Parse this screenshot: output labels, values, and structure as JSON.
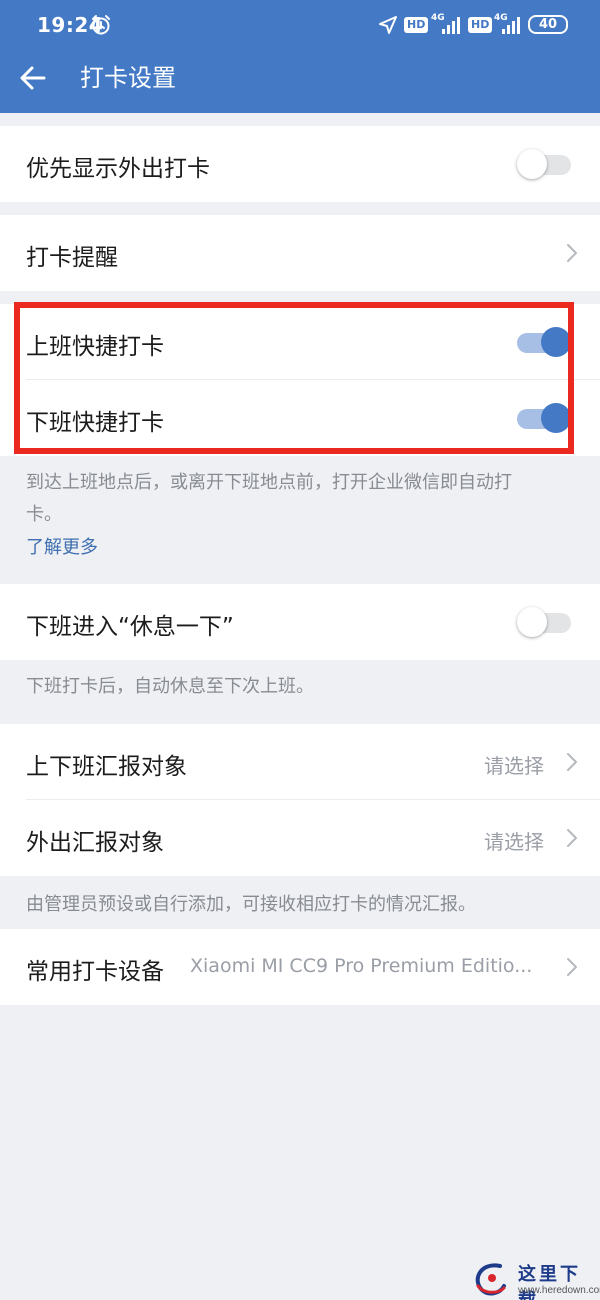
{
  "status_bar": {
    "time": "19:24",
    "hd_1": "HD",
    "net_1": "4G",
    "hd_2": "HD",
    "net_2": "4G",
    "battery": "40"
  },
  "header": {
    "title": "打卡设置"
  },
  "settings": {
    "prefer_outing": {
      "label": "优先显示外出打卡",
      "enabled": false
    },
    "clock_reminder": {
      "label": "打卡提醒"
    },
    "quick_clock_in": {
      "label": "上班快捷打卡",
      "enabled": true
    },
    "quick_clock_out": {
      "label": "下班快捷打卡",
      "enabled": true
    },
    "quick_desc_1": "到达上班地点后，或离开下班地点前，打开企业微信即自动打",
    "quick_desc_2": "卡。",
    "learn_more": "了解更多",
    "rest_after_work": {
      "label": "下班进入“休息一下”",
      "enabled": false
    },
    "rest_desc": "下班打卡后，自动休息至下次上班。",
    "report_commute": {
      "label": "上下班汇报对象",
      "value": "请选择"
    },
    "report_outing": {
      "label": "外出汇报对象",
      "value": "请选择"
    },
    "report_desc": "由管理员预设或自行添加，可接收相应打卡的情况汇报。",
    "common_device": {
      "label": "常用打卡设备",
      "value": "Xiaomi MI CC9 Pro Premium Editio..."
    }
  },
  "colors": {
    "header": "#4479c6",
    "toggle_on": "#4479c6",
    "highlight": "#ea2a20"
  },
  "watermark": {
    "title": "这里下载",
    "url": "www.heredown.com"
  }
}
